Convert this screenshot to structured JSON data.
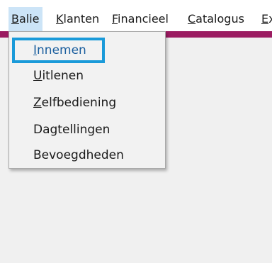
{
  "menubar": {
    "items": [
      {
        "mnemonic": "B",
        "rest": "alie"
      },
      {
        "mnemonic": "K",
        "rest": "lanten"
      },
      {
        "mnemonic": "F",
        "rest": "inancieel"
      },
      {
        "mnemonic": "C",
        "rest": "atalogus"
      },
      {
        "mnemonic": "E",
        "rest": "x"
      }
    ]
  },
  "dropdown": {
    "items": [
      {
        "mnemonic": "I",
        "rest": "nnemen"
      },
      {
        "mnemonic": "U",
        "rest": "itlenen"
      },
      {
        "mnemonic": "Z",
        "rest": "elfbediening"
      },
      {
        "mnemonic": "",
        "rest": "Dagtellingen"
      },
      {
        "mnemonic": "",
        "rest": "Bevoegdheden"
      }
    ]
  },
  "colors": {
    "accent_band": "#9b1b61",
    "active_menu": "#cce4f7",
    "highlight_border": "#1a9ad9"
  }
}
